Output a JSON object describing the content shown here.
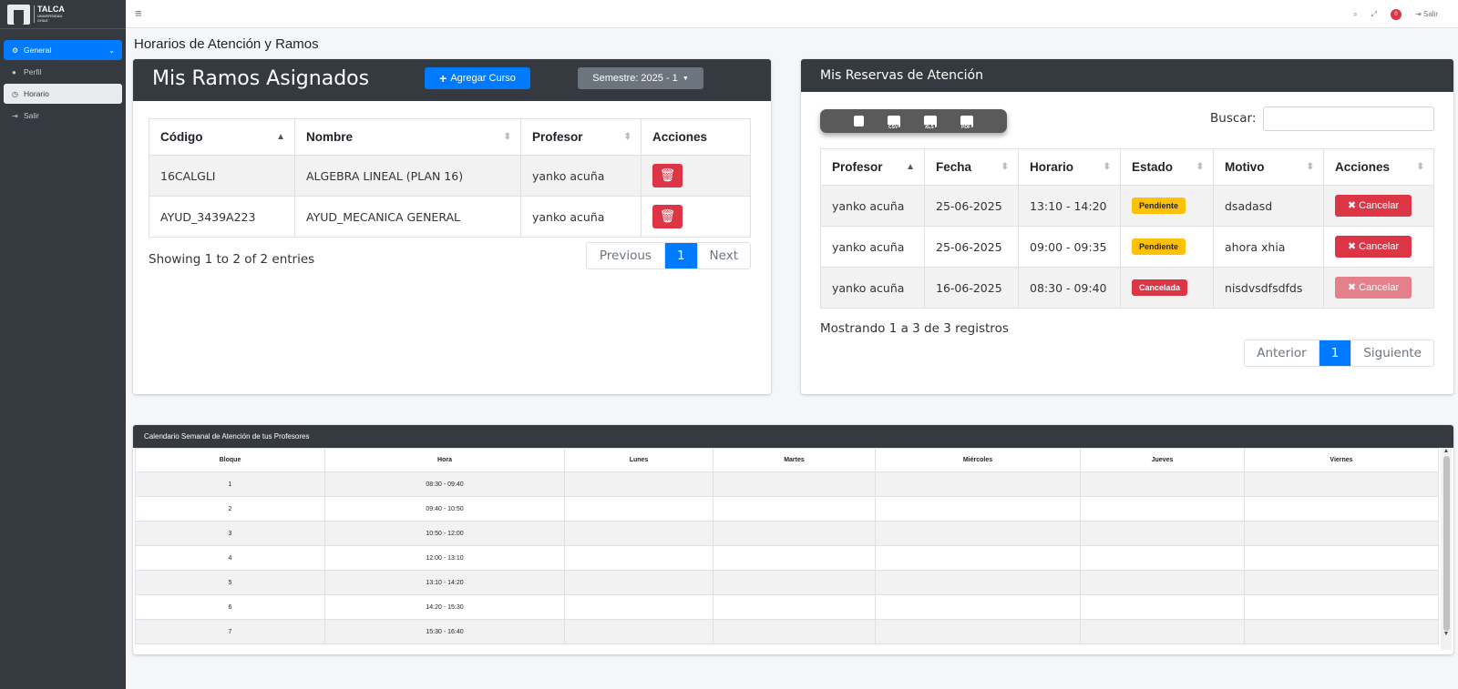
{
  "brand": {
    "name": "TALCA",
    "sub": "UNIVERSIDAD",
    "sub2": "CHILE"
  },
  "sidebar": {
    "items": [
      {
        "label": "General",
        "icon": "gear-icon"
      },
      {
        "label": "Perfil",
        "icon": "user-icon"
      },
      {
        "label": "Horario",
        "icon": "clock-icon"
      },
      {
        "label": "Salir",
        "icon": "sign-out-icon"
      }
    ]
  },
  "topbar": {
    "notif_count": "0",
    "logout": "Salir"
  },
  "page": {
    "title": "Horarios de Atención y Ramos"
  },
  "ramos": {
    "title": "Mis Ramos Asignados",
    "add_button": "Agregar Curso",
    "semester_button": "Semestre: 2025 - 1",
    "columns": [
      "Código",
      "Nombre",
      "Profesor",
      "Acciones"
    ],
    "rows": [
      {
        "codigo": "16CALGLI",
        "nombre": "ALGEBRA LINEAL (PLAN 16)",
        "profesor": "yanko acuña"
      },
      {
        "codigo": "AYUD_3439A223",
        "nombre": "AYUD_MECANICA GENERAL",
        "profesor": "yanko acuña"
      }
    ],
    "info": "Showing 1 to 2 of 2 entries",
    "pager": {
      "prev": "Previous",
      "page": "1",
      "next": "Next"
    }
  },
  "reservas": {
    "title": "Mis Reservas de Atención",
    "export": [
      "CSV",
      "XLS",
      "PDF"
    ],
    "search_label": "Buscar:",
    "search_value": "",
    "columns": [
      "Profesor",
      "Fecha",
      "Horario",
      "Estado",
      "Motivo",
      "Acciones"
    ],
    "rows": [
      {
        "profesor": "yanko acuña",
        "fecha": "25-06-2025",
        "horario": "13:10 - 14:20",
        "estado": "Pendiente",
        "motivo": "dsadasd",
        "accion": "Cancelar"
      },
      {
        "profesor": "yanko acuña",
        "fecha": "25-06-2025",
        "horario": "09:00 - 09:35",
        "estado": "Pendiente",
        "motivo": "ahora xhia",
        "accion": "Cancelar"
      },
      {
        "profesor": "yanko acuña",
        "fecha": "16-06-2025",
        "horario": "08:30 - 09:40",
        "estado": "Cancelada",
        "motivo": "nisdvsdfsdfds",
        "accion": "Cancelar"
      }
    ],
    "info": "Mostrando 1 a 3 de 3 registros",
    "pager": {
      "prev": "Anterior",
      "page": "1",
      "next": "Siguiente"
    }
  },
  "calendario": {
    "title": "Calendario Semanal de Atención de tus Profesores",
    "columns": [
      "Bloque",
      "Hora",
      "Lunes",
      "Martes",
      "Miércoles",
      "Jueves",
      "Viernes"
    ],
    "rows": [
      {
        "bloque": "1",
        "hora": "08:30 - 09:40"
      },
      {
        "bloque": "2",
        "hora": "09:40 - 10:50"
      },
      {
        "bloque": "3",
        "hora": "10:50 - 12:00"
      },
      {
        "bloque": "4",
        "hora": "12:00 - 13:10"
      },
      {
        "bloque": "5",
        "hora": "13:10 - 14:20"
      },
      {
        "bloque": "6",
        "hora": "14:20 - 15:30"
      },
      {
        "bloque": "7",
        "hora": "15:30 - 16:40"
      }
    ]
  },
  "colors": {
    "primary": "#007bff",
    "danger": "#dc3545",
    "warning": "#ffc107",
    "dark": "#343a40",
    "secondary": "#6c757d"
  }
}
